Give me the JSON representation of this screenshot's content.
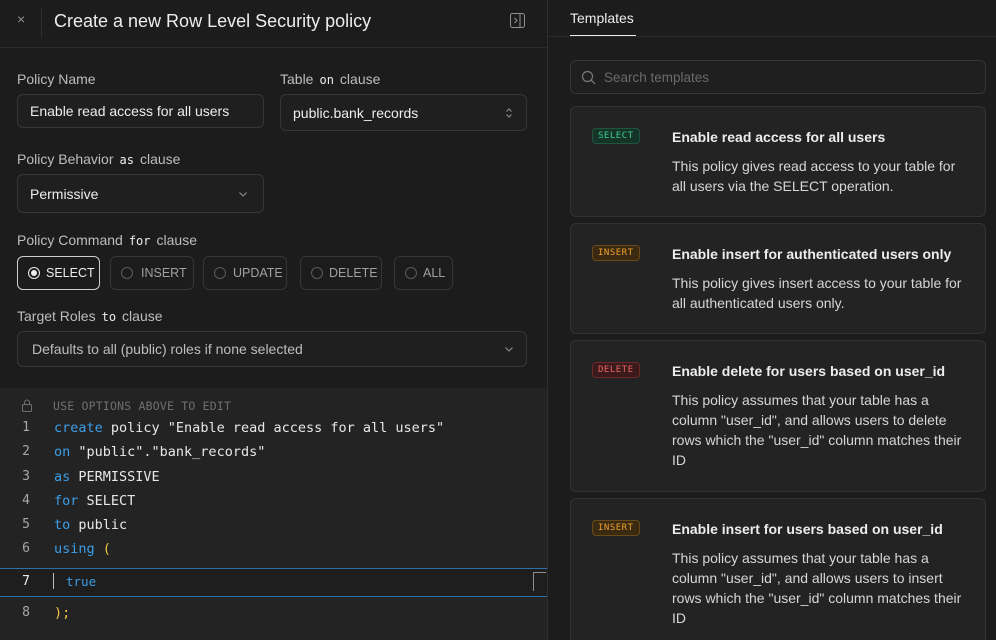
{
  "header": {
    "title": "Create a new Row Level Security policy",
    "close_label": "×"
  },
  "form": {
    "policy_name": {
      "label": "Policy Name",
      "value": "Enable read access for all users"
    },
    "table": {
      "label": "Table",
      "keyword": "on",
      "suffix": "clause",
      "value": "public.bank_records"
    },
    "behavior": {
      "label": "Policy Behavior",
      "keyword": "as",
      "suffix": "clause",
      "value": "Permissive"
    },
    "command": {
      "label": "Policy Command",
      "keyword": "for",
      "suffix": "clause",
      "options": [
        "SELECT",
        "INSERT",
        "UPDATE",
        "DELETE",
        "ALL"
      ],
      "selected": "SELECT"
    },
    "roles": {
      "label": "Target Roles",
      "keyword": "to",
      "suffix": "clause",
      "placeholder": "Defaults to all (public) roles if none selected"
    }
  },
  "editor": {
    "hint": "USE OPTIONS ABOVE TO EDIT",
    "lines": [
      {
        "num": "1",
        "kw": "create",
        "rest": " policy \"Enable read access for all users\""
      },
      {
        "num": "2",
        "kw": "on",
        "rest": " \"public\".\"bank_records\""
      },
      {
        "num": "3",
        "kw": "as",
        "rest": " PERMISSIVE"
      },
      {
        "num": "4",
        "kw": "for",
        "rest": " SELECT"
      },
      {
        "num": "5",
        "kw": "to",
        "rest": " public"
      },
      {
        "num": "6",
        "kw": "using",
        "rest": " ("
      },
      {
        "num": "7",
        "kw": "",
        "rest": "true"
      },
      {
        "num": "8",
        "kw": "",
        "rest": ");"
      }
    ]
  },
  "templates_panel": {
    "tab_label": "Templates",
    "search_placeholder": "Search templates",
    "templates": [
      {
        "badge": "SELECT",
        "title": "Enable read access for all users",
        "description": "This policy gives read access to your table for all users via the SELECT operation."
      },
      {
        "badge": "INSERT",
        "title": "Enable insert for authenticated users only",
        "description": "This policy gives insert access to your table for all authenticated users only."
      },
      {
        "badge": "DELETE",
        "title": "Enable delete for users based on user_id",
        "description": "This policy assumes that your table has a column \"user_id\", and allows users to delete rows which the \"user_id\" column matches their ID"
      },
      {
        "badge": "INSERT",
        "title": "Enable insert for users based on user_id",
        "description": "This policy assumes that your table has a column \"user_id\", and allows users to insert rows which the \"user_id\" column matches their ID"
      }
    ]
  },
  "colors": {
    "background": "#1c1c1c",
    "editor_keyword": "#3b9ee8",
    "editor_paren": "#f5c242",
    "badge_select": "#3ecf8e",
    "badge_insert": "#f0a030",
    "badge_delete": "#f26363"
  }
}
